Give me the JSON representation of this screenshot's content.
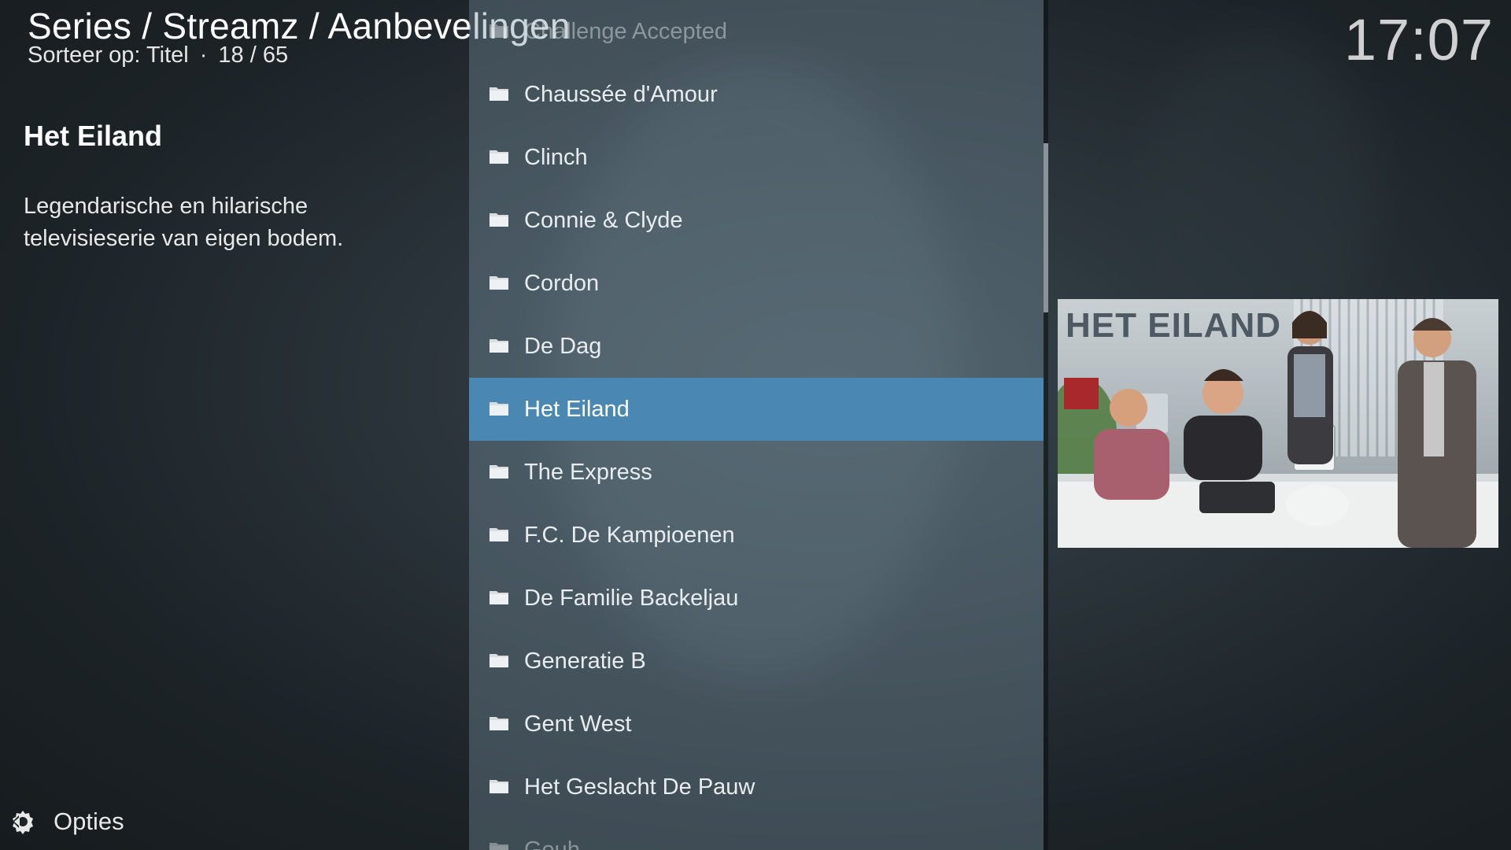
{
  "header": {
    "breadcrumb": "Series / Streamz / Aanbevelingen",
    "sort_label": "Sorteer op: Titel",
    "separator": "·",
    "position": "18 / 65"
  },
  "clock": "17:07",
  "info": {
    "title": "Het Eiland",
    "plot": "Legendarische en hilarische televisieserie van eigen bodem."
  },
  "list": {
    "items": [
      {
        "label": "Challenge Accepted"
      },
      {
        "label": "Chaussée d'Amour"
      },
      {
        "label": "Clinch"
      },
      {
        "label": "Connie & Clyde"
      },
      {
        "label": "Cordon"
      },
      {
        "label": "De Dag"
      },
      {
        "label": "Het Eiland"
      },
      {
        "label": "The Express"
      },
      {
        "label": "F.C. De Kampioenen"
      },
      {
        "label": "De Familie Backeljau"
      },
      {
        "label": "Generatie B"
      },
      {
        "label": "Gent West"
      },
      {
        "label": "Het Geslacht De Pauw"
      },
      {
        "label": "Gouh"
      }
    ],
    "selected_index": 6
  },
  "poster": {
    "title_text": "HET EILAND"
  },
  "footer": {
    "options_label": "Opties",
    "options_icon": "options-gear-icon"
  },
  "colors": {
    "selection": "#4a87b3",
    "background": "#1c2226"
  }
}
